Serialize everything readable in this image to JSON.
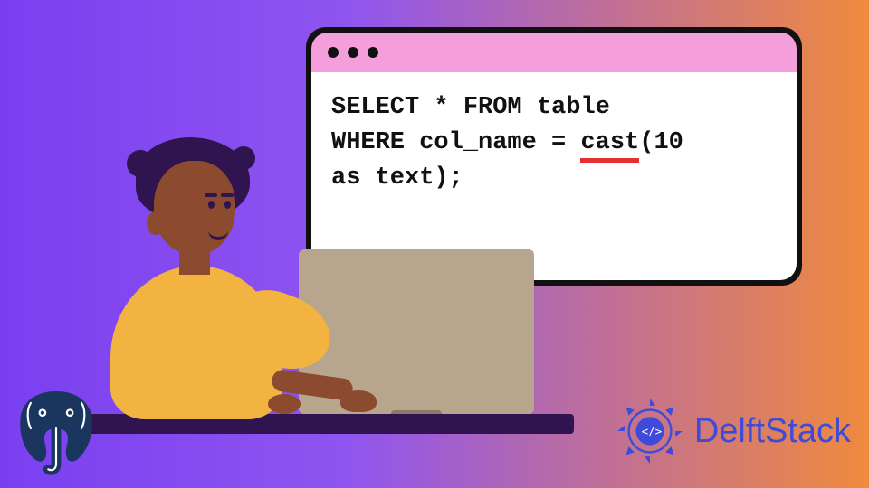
{
  "code": {
    "line1_a": "SELECT * FROM table",
    "line2_a": "WHERE col_name = ",
    "line2_cast": "cast",
    "line2_b": "(10",
    "line3": "as text);"
  },
  "logo": {
    "delftstack_text": "DelftStack"
  },
  "colors": {
    "bg_left": "#7a3ff0",
    "bg_right": "#f08a3d",
    "titlebar": "#f49fdc",
    "window_border": "#111111",
    "underline": "#e43030",
    "shirt": "#f2b340",
    "skin": "#8c4a2e",
    "dark": "#2f144f",
    "monitor": "#b8a58e",
    "delft_blue": "#3e4bd8"
  }
}
